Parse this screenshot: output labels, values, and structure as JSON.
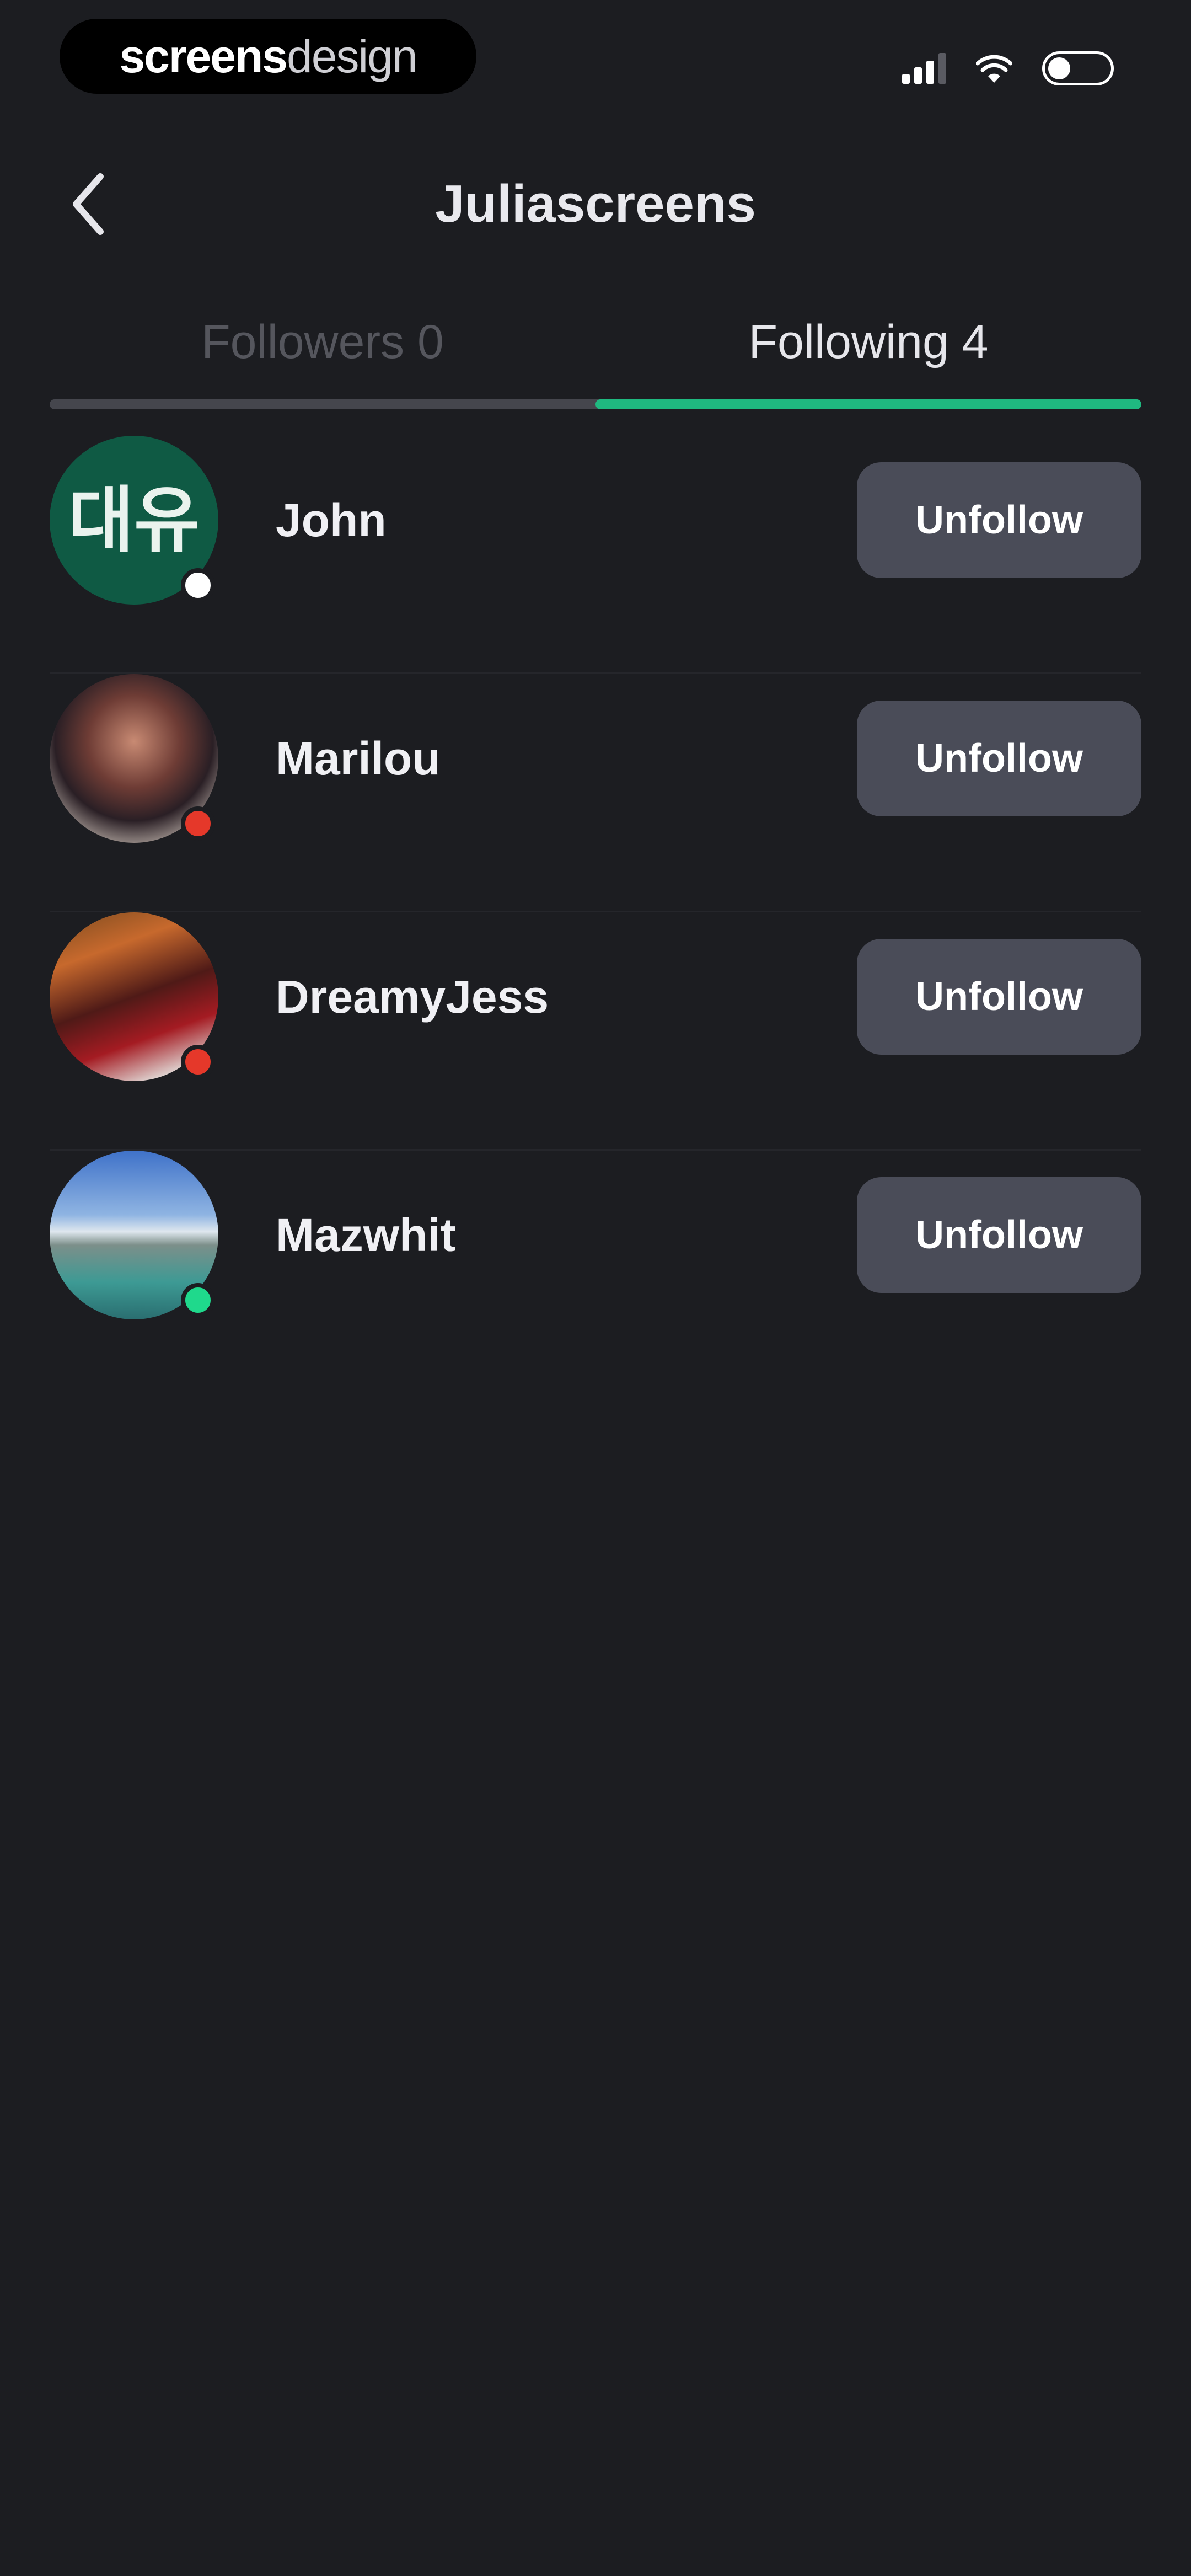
{
  "status_bar": {
    "brand_bold": "screens",
    "brand_light": "design",
    "signal_icon": "signal-icon",
    "wifi_icon": "wifi-icon",
    "battery_icon": "battery-icon"
  },
  "header": {
    "back_icon": "chevron-left-icon",
    "title": "Juliascreens"
  },
  "tabs": [
    {
      "label": "Followers 0",
      "active": false
    },
    {
      "label": "Following 4",
      "active": true
    }
  ],
  "colors": {
    "background": "#1c1d21",
    "accent": "#1fb980",
    "button": "#4a4c58",
    "status_offline": "#ffffff",
    "status_busy": "#e5382a",
    "status_online": "#1fd98c"
  },
  "following": [
    {
      "name": "John",
      "avatar_text": "대유",
      "status": "offline",
      "button_label": "Unfollow"
    },
    {
      "name": "Marilou",
      "status": "busy",
      "button_label": "Unfollow"
    },
    {
      "name": "DreamyJess",
      "status": "busy",
      "button_label": "Unfollow"
    },
    {
      "name": "Mazwhit",
      "status": "online",
      "button_label": "Unfollow"
    }
  ]
}
